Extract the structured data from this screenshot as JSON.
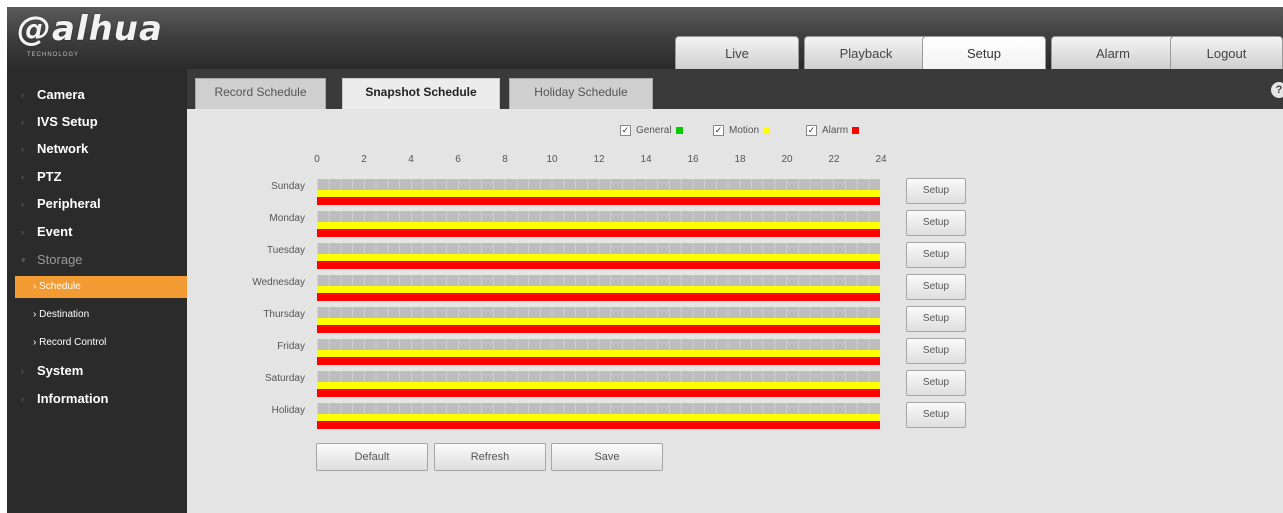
{
  "logo": {
    "text": "alhua",
    "tagline": "TECHNOLOGY"
  },
  "nav": {
    "tabs": [
      {
        "label": "Live",
        "active": false
      },
      {
        "label": "Playback",
        "active": false
      },
      {
        "label": "Setup",
        "active": true
      },
      {
        "label": "Alarm",
        "active": false
      },
      {
        "label": "Logout",
        "active": false
      }
    ]
  },
  "sidebar": {
    "items": [
      {
        "label": "Camera"
      },
      {
        "label": "IVS Setup"
      },
      {
        "label": "Network"
      },
      {
        "label": "PTZ"
      },
      {
        "label": "Peripheral"
      },
      {
        "label": "Event"
      },
      {
        "label": "Storage",
        "expanded": true
      },
      {
        "label": "Schedule",
        "active": true
      },
      {
        "label": "Destination"
      },
      {
        "label": "Record Control"
      },
      {
        "label": "System"
      },
      {
        "label": "Information"
      }
    ]
  },
  "subtabs": [
    {
      "label": "Record Schedule",
      "active": false
    },
    {
      "label": "Snapshot Schedule",
      "active": true
    },
    {
      "label": "Holiday Schedule",
      "active": false
    }
  ],
  "legend": {
    "items": [
      {
        "label": "General",
        "checked": true,
        "color": "#00cc00"
      },
      {
        "label": "Motion",
        "checked": true,
        "color": "#ffff00"
      },
      {
        "label": "Alarm",
        "checked": true,
        "color": "#ff0000"
      }
    ]
  },
  "schedule": {
    "hours": [
      "0",
      "2",
      "4",
      "6",
      "8",
      "10",
      "12",
      "14",
      "16",
      "18",
      "20",
      "22",
      "24"
    ],
    "days": [
      {
        "label": "Sunday",
        "setup_label": "Setup"
      },
      {
        "label": "Monday",
        "setup_label": "Setup"
      },
      {
        "label": "Tuesday",
        "setup_label": "Setup"
      },
      {
        "label": "Wednesday",
        "setup_label": "Setup"
      },
      {
        "label": "Thursday",
        "setup_label": "Setup"
      },
      {
        "label": "Friday",
        "setup_label": "Setup"
      },
      {
        "label": "Saturday",
        "setup_label": "Setup"
      },
      {
        "label": "Holiday",
        "setup_label": "Setup"
      }
    ],
    "active_events": [
      "Motion",
      "Alarm"
    ],
    "coverage_hours": [
      0,
      24
    ]
  },
  "buttons": {
    "default": "Default",
    "refresh": "Refresh",
    "save": "Save"
  },
  "colors": {
    "accent": "#f29b32",
    "motion": "#ffff00",
    "alarm": "#ff0000",
    "general": "#00cc00"
  }
}
